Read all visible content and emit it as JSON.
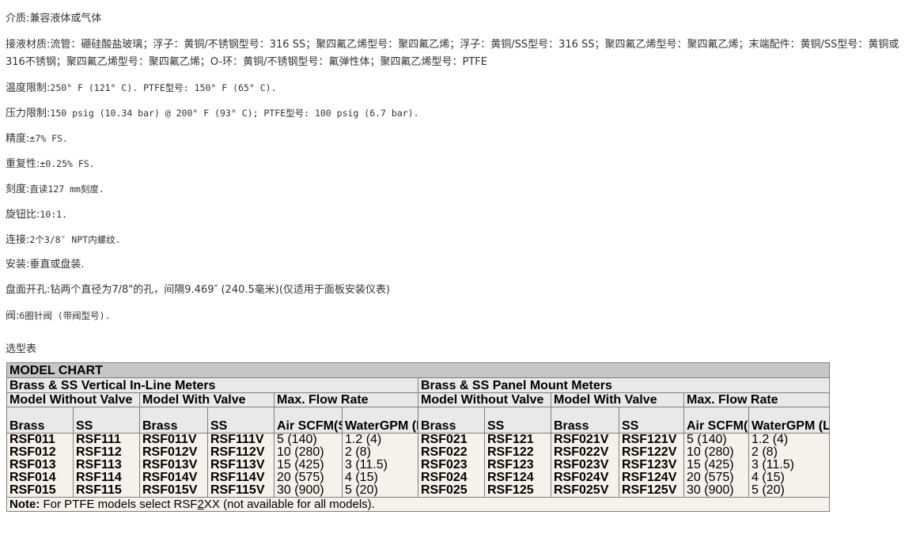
{
  "specs": {
    "medium": "介质:兼容液体或气体",
    "wetted": "接液材质:流管：硼硅酸盐玻璃；浮子：黄铜/不锈钢型号：316 SS；聚四氟乙烯型号：聚四氟乙烯；浮子：黄铜/SS型号：316 SS；聚四氟乙烯型号：聚四氟乙烯；末端配件：黄铜/SS型号：黄铜或316不锈钢；聚四氟乙烯型号：聚四氟乙烯；O-环：黄铜/不锈钢型号：氟弹性体；聚四氟乙烯型号：PTFE",
    "temp_label": "温度限制:",
    "temp_value": "250° F (121° C). PTFE型号: 150° F (65° C).",
    "pressure_label": "压力限制:",
    "pressure_value": "150 psig (10.34 bar) @ 200° F (93° C); PTFE型号: 100 psig (6.7 bar).",
    "accuracy_label": "精度:",
    "accuracy_value": "±7% FS.",
    "repeat_label": "重复性:",
    "repeat_value": "±0.25% FS.",
    "scale_label": "刻度:",
    "scale_value": "直读127 mm刻度.",
    "turndown_label": "旋钮比:",
    "turndown_value": "10:1.",
    "connection_label": "连接:",
    "connection_value": "2个3/8″ NPT内螺纹.",
    "mounting_label": "安装:",
    "mounting_value": "垂直或盘装.",
    "panel_cutout": "盘面开孔:钻两个直径为7/8\"的孔，间隔9.469″ (240.5毫米)(仅适用于面板安装仪表)",
    "valve_label": "阀:",
    "valve_value": "6圈针阀 (带阀型号).",
    "selection_title": "选型表"
  },
  "chart": {
    "title": "MODEL CHART",
    "group_inline": "Brass & SS Vertical In-Line Meters",
    "group_panel": "Brass & SS Panel Mount Meters",
    "sub_without_valve": "Model Without Valve",
    "sub_with_valve": "Model With Valve",
    "sub_max_flow": "Max. Flow Rate",
    "col_brass": "Brass",
    "col_ss": "SS",
    "col_air_1": "Air SCFM",
    "col_air_2": "(SLPM)",
    "col_water_1": "Water",
    "col_water_2": "GPM (LPM)",
    "inline_brass": [
      "RSF011",
      "RSF012",
      "RSF013",
      "RSF014",
      "RSF015"
    ],
    "inline_ss": [
      "RSF111",
      "RSF112",
      "RSF113",
      "RSF114",
      "RSF115"
    ],
    "inline_brass_v": [
      "RSF011V",
      "RSF012V",
      "RSF013V",
      "RSF014V",
      "RSF015V"
    ],
    "inline_ss_v": [
      "RSF111V",
      "RSF112V",
      "RSF113V",
      "RSF114V",
      "RSF115V"
    ],
    "inline_air": [
      "5 (140)",
      "10 (280)",
      "15 (425)",
      "20 (575)",
      "30 (900)"
    ],
    "inline_water": [
      "1.2 (4)",
      "2 (8)",
      "3 (11.5)",
      "4 (15)",
      "5 (20)"
    ],
    "panel_brass": [
      "RSF021",
      "RSF022",
      "RSF023",
      "RSF024",
      "RSF025"
    ],
    "panel_ss": [
      "RSF121",
      "RSF122",
      "RSF123",
      "RSF124",
      "RSF125"
    ],
    "panel_brass_v": [
      "RSF021V",
      "RSF022V",
      "RSF023V",
      "RSF024V",
      "RSF025V"
    ],
    "panel_ss_v": [
      "RSF121V",
      "RSF122V",
      "RSF123V",
      "RSF124V",
      "RSF125V"
    ],
    "panel_air": [
      "5 (140)",
      "10 (280)",
      "15 (425)",
      "20 (575)",
      "30 (900)"
    ],
    "panel_water": [
      "1.2 (4)",
      "2 (8)",
      "3 (11.5)",
      "4 (15)",
      "5 (20)"
    ],
    "note_label": "Note:",
    "note_text_a": " For PTFE models select RSF",
    "note_text_u": "2",
    "note_text_b": "XX   (not available for all models)."
  }
}
